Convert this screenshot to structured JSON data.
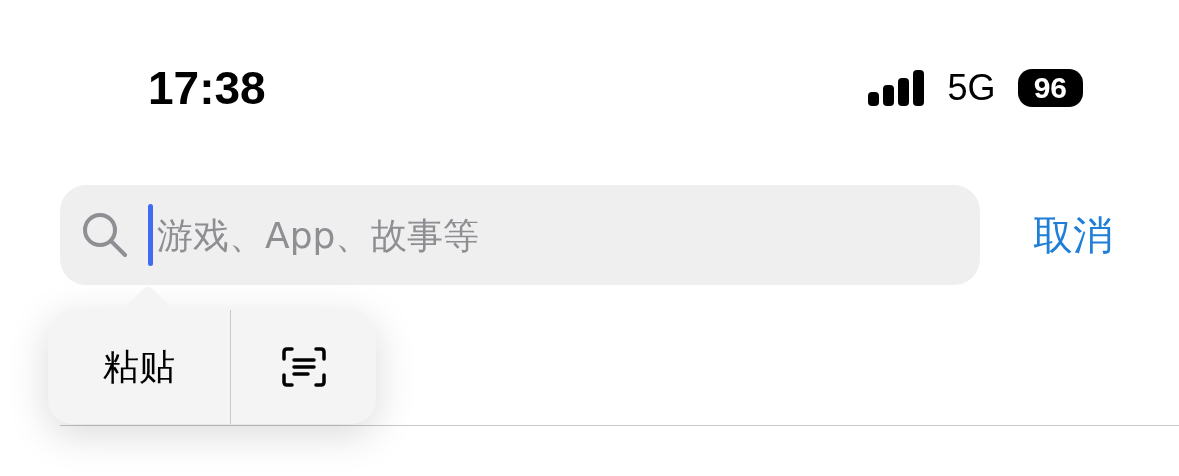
{
  "status_bar": {
    "time": "17:38",
    "network": "5G",
    "battery": "96"
  },
  "search": {
    "placeholder": "游戏、App、故事等",
    "focused": true
  },
  "cancel_button": {
    "label": "取消"
  },
  "context_menu": {
    "items": [
      {
        "kind": "text",
        "label": "粘贴"
      },
      {
        "kind": "scan-text"
      }
    ]
  }
}
